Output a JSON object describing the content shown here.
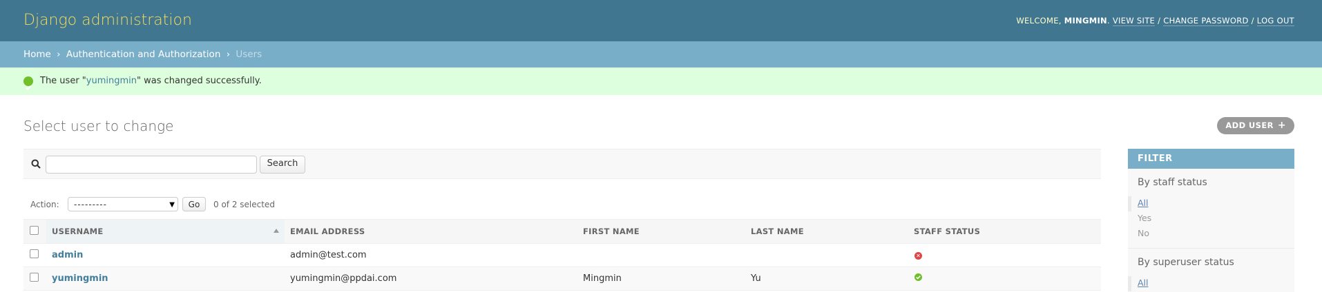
{
  "header": {
    "site_name": "Django administration",
    "welcome": "WELCOME,",
    "username": "MINGMIN",
    "view_site": "VIEW SITE",
    "change_password": "CHANGE PASSWORD",
    "log_out": "LOG OUT",
    "separator": "/"
  },
  "breadcrumbs": {
    "home": "Home",
    "section": "Authentication and Authorization",
    "current": "Users",
    "separator": "›"
  },
  "message": {
    "prefix": "The user \"",
    "user": "yumingmin",
    "suffix": "\" was changed successfully."
  },
  "page": {
    "title": "Select user to change",
    "add_button": "ADD USER",
    "add_icon": "+"
  },
  "search": {
    "value": "",
    "button": "Search"
  },
  "actions": {
    "label": "Action:",
    "selected_option": "---------",
    "go": "Go",
    "counter": "0 of 2 selected"
  },
  "table": {
    "headers": {
      "username": "USERNAME",
      "email": "EMAIL ADDRESS",
      "first_name": "FIRST NAME",
      "last_name": "LAST NAME",
      "staff_status": "STAFF STATUS"
    },
    "rows": [
      {
        "username": "admin",
        "email": "admin@test.com",
        "first_name": "",
        "last_name": "",
        "staff_status": "no"
      },
      {
        "username": "yumingmin",
        "email": "yumingmin@ppdai.com",
        "first_name": "Mingmin",
        "last_name": "Yu",
        "staff_status": "yes"
      }
    ]
  },
  "filter": {
    "title": "FILTER",
    "groups": [
      {
        "title": "By staff status",
        "options": [
          "All",
          "Yes",
          "No"
        ],
        "selected": "All"
      },
      {
        "title": "By superuser status",
        "options": [
          "All"
        ],
        "selected": "All"
      }
    ]
  },
  "colors": {
    "header_bg": "#417690",
    "site_name": "#f5dd5d",
    "breadcrumbs_bg": "#79aec8",
    "message_bg": "#ddffdd",
    "link": "#447e9b",
    "success": "#70bf2b",
    "error": "#dd4646"
  },
  "icons": {
    "search": "search-icon",
    "success": "check-circle-icon",
    "staff_no": "x-circle-icon",
    "staff_yes": "check-circle-icon",
    "sort": "sort-ascending-icon",
    "select_arrow": "chevron-down-icon"
  }
}
